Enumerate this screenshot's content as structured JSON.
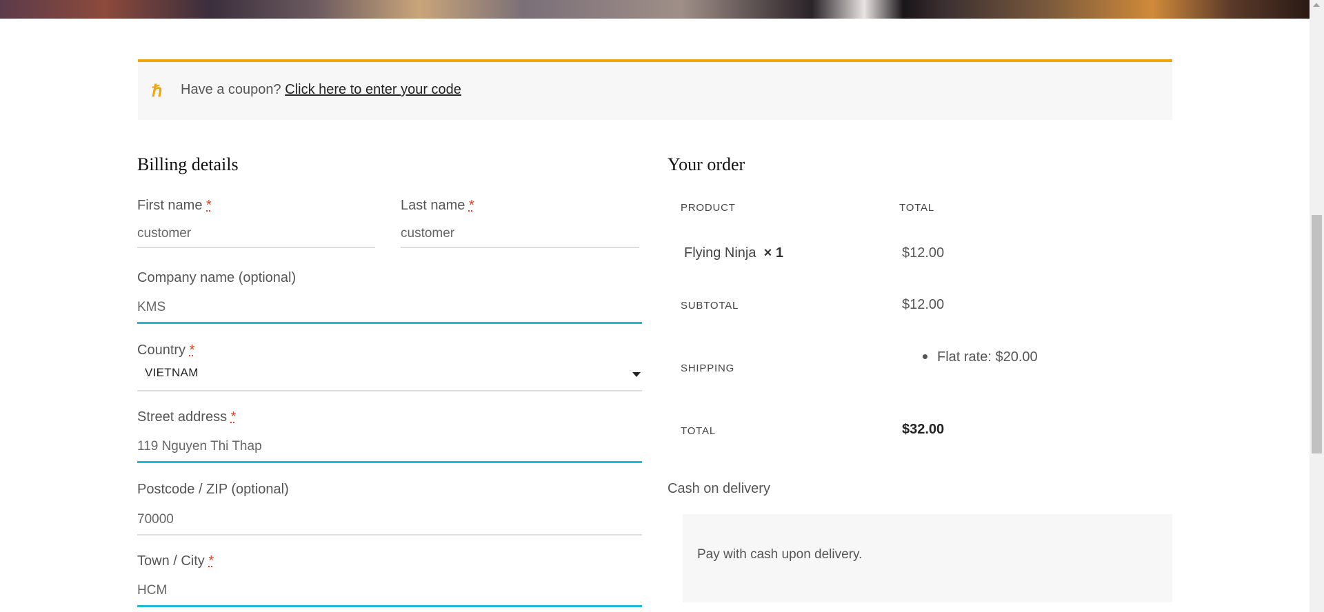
{
  "coupon": {
    "icon": "coupon-icon",
    "prompt": "Have a coupon?",
    "link": "Click here to enter your code"
  },
  "billing": {
    "title": "Billing details",
    "first_name": {
      "label": "First name",
      "value": "customer"
    },
    "last_name": {
      "label": "Last name",
      "value": "customer"
    },
    "company": {
      "label": "Company name (optional)",
      "value": "KMS"
    },
    "country": {
      "label": "Country",
      "value": "VIETNAM"
    },
    "street": {
      "label": "Street address",
      "value": "119 Nguyen Thi Thap"
    },
    "postcode": {
      "label": "Postcode / ZIP (optional)",
      "value": "70000"
    },
    "city": {
      "label": "Town / City",
      "value": "HCM"
    },
    "required_mark": "*"
  },
  "order": {
    "title": "Your order",
    "col_product": "PRODUCT",
    "col_total": "TOTAL",
    "item": {
      "name": "Flying Ninja",
      "qty": "× 1",
      "total": "$12.00"
    },
    "subtotal_label": "SUBTOTAL",
    "subtotal_value": "$12.00",
    "shipping_label": "SHIPPING",
    "shipping_value": "Flat rate: $20.00",
    "total_label": "TOTAL",
    "total_value": "$32.00"
  },
  "payment": {
    "method": "Cash on delivery",
    "description": "Pay with cash upon delivery."
  },
  "colors": {
    "accent_orange": "#f0a30a",
    "focus_cyan": "#1fbad6",
    "required_red": "#e2401c"
  }
}
